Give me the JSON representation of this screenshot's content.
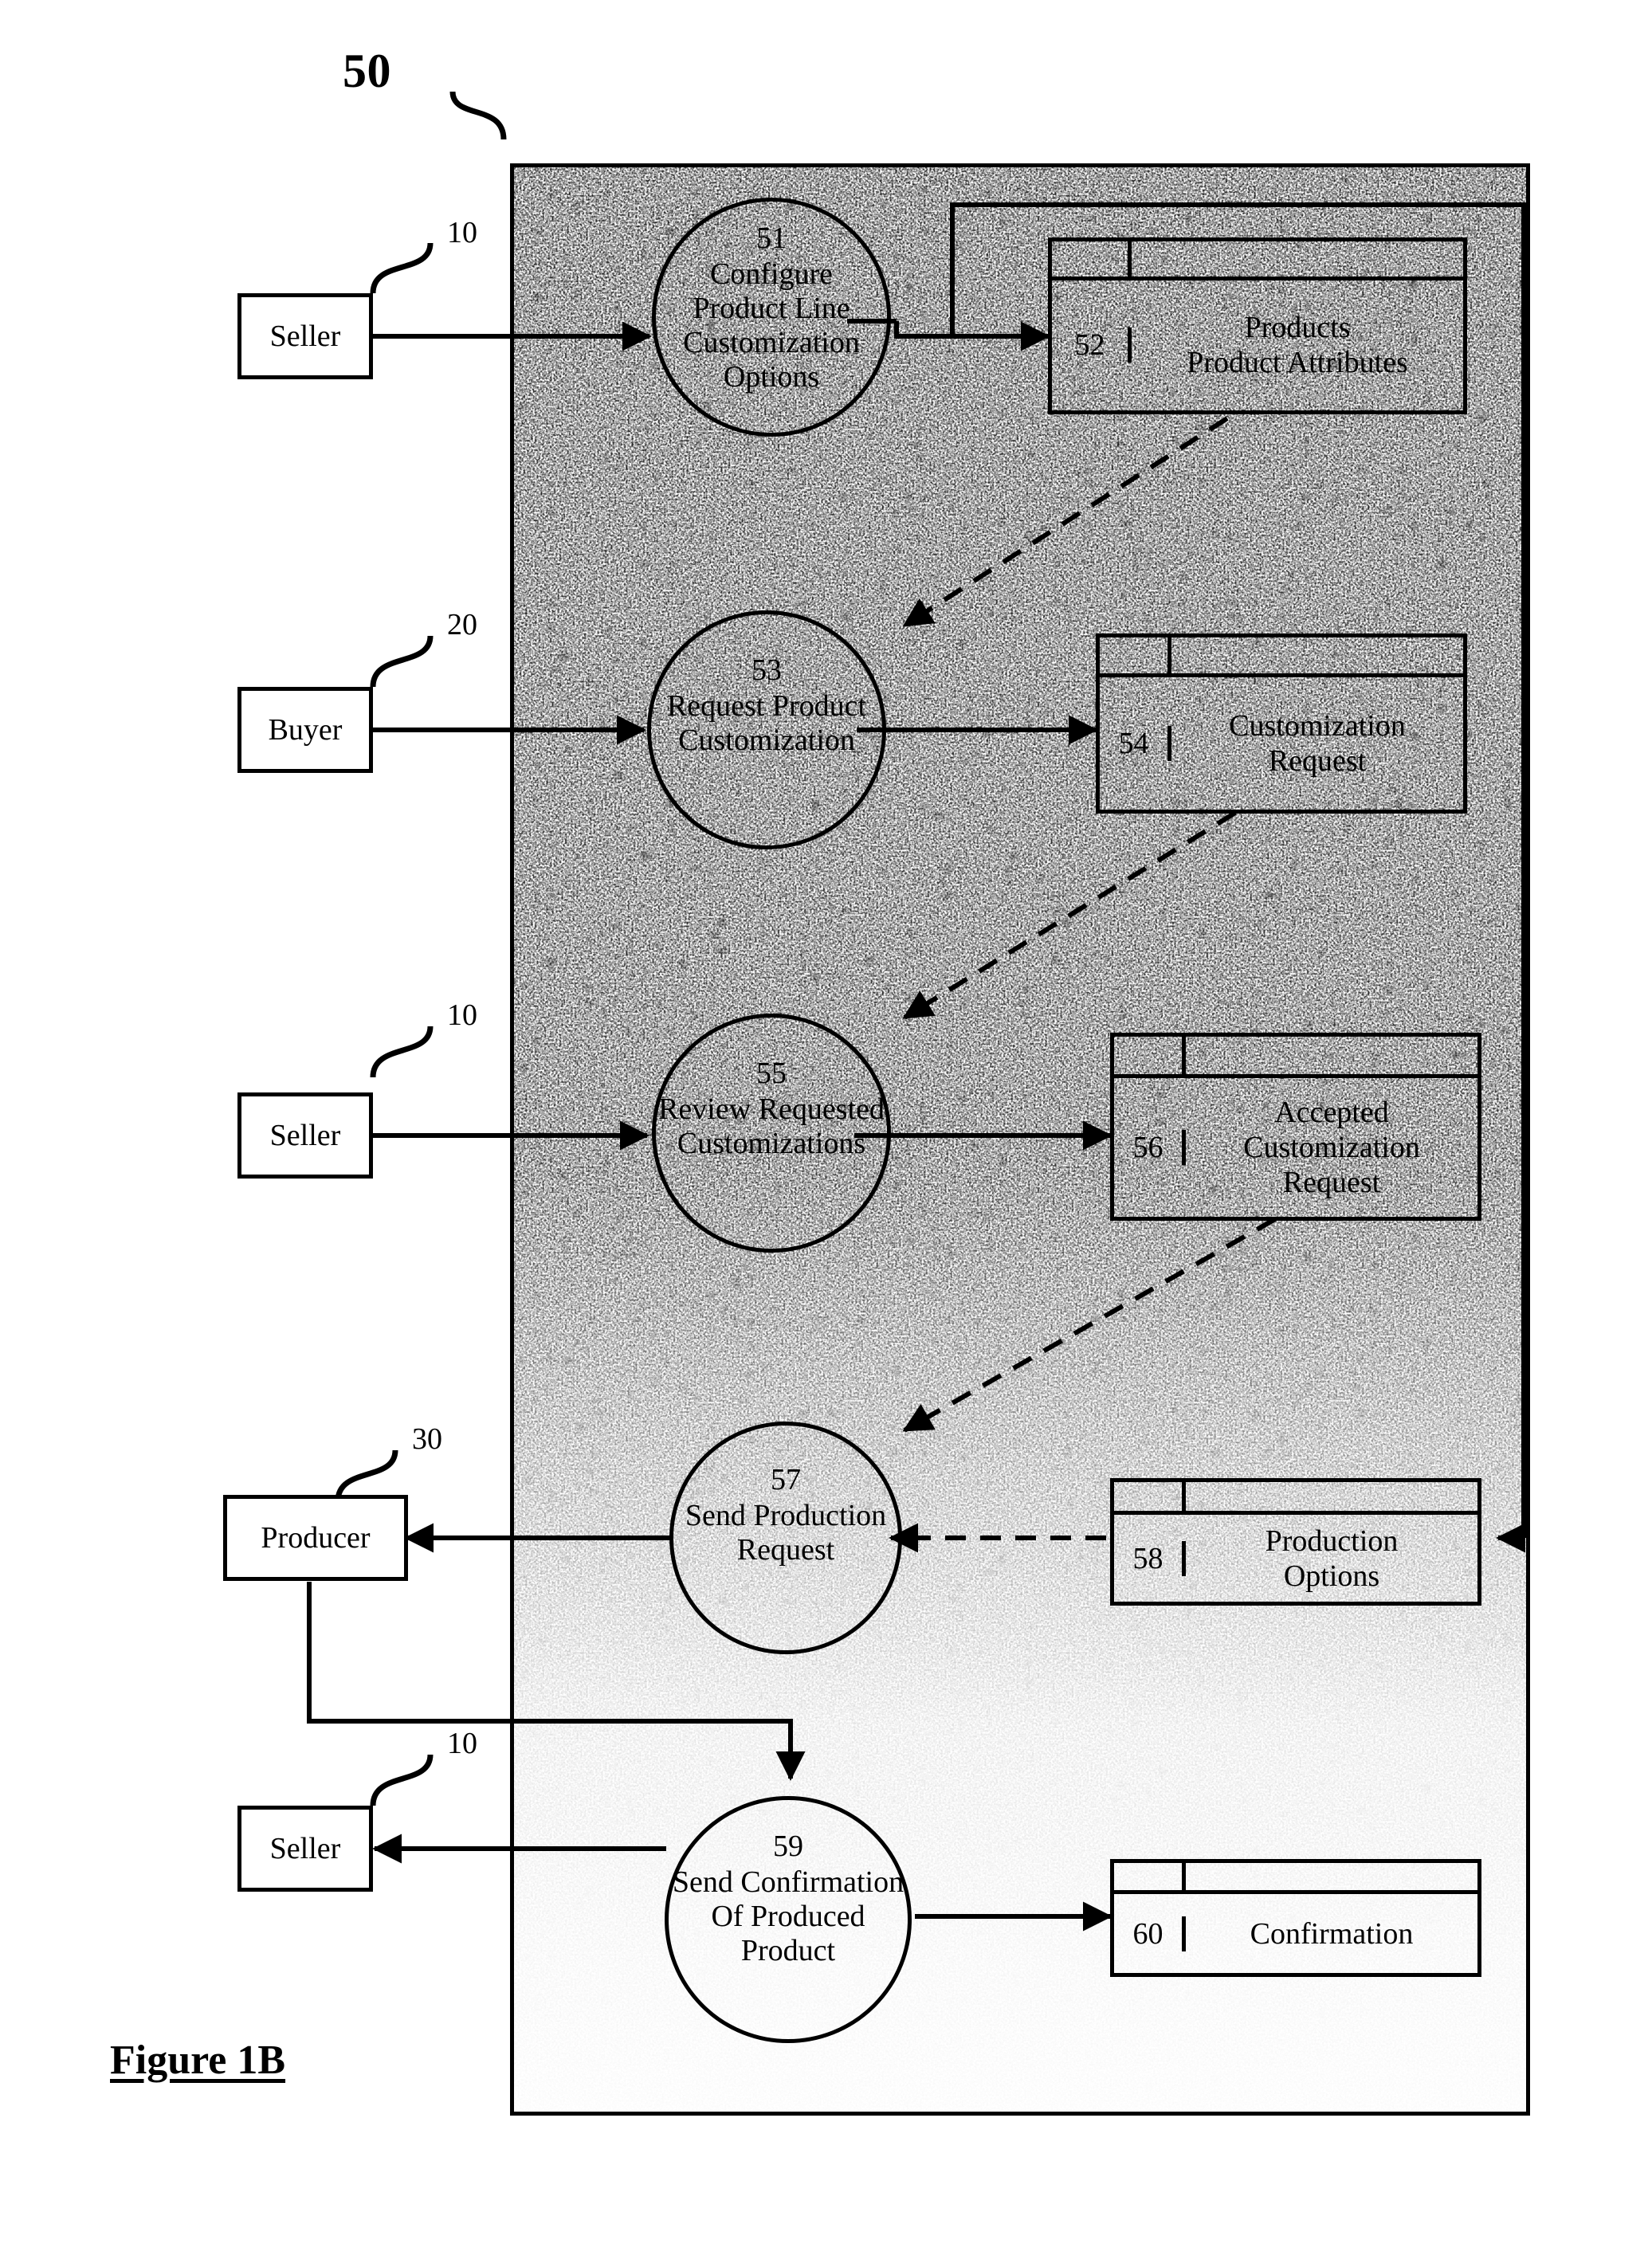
{
  "figure": {
    "caption": "Figure 1B",
    "system_ref": "50"
  },
  "entities": [
    {
      "name": "seller-1",
      "label": "Seller",
      "ref": "10"
    },
    {
      "name": "buyer",
      "label": "Buyer",
      "ref": "20"
    },
    {
      "name": "seller-2",
      "label": "Seller",
      "ref": "10"
    },
    {
      "name": "producer",
      "label": "Producer",
      "ref": "30"
    },
    {
      "name": "seller-3",
      "label": "Seller",
      "ref": "10"
    }
  ],
  "processes": [
    {
      "id": "51",
      "lines": [
        "Configure",
        "Product Line",
        "Customization",
        "Options"
      ]
    },
    {
      "id": "53",
      "lines": [
        "Request Product",
        "Customization"
      ]
    },
    {
      "id": "55",
      "lines": [
        "Review Requested",
        "Customizations"
      ]
    },
    {
      "id": "57",
      "lines": [
        "Send Production",
        "Request"
      ]
    },
    {
      "id": "59",
      "lines": [
        "Send Confirmation",
        "Of Produced",
        "Product"
      ]
    }
  ],
  "data_stores": [
    {
      "id": "52",
      "lines": [
        "Products",
        "Product Attributes"
      ]
    },
    {
      "id": "54",
      "lines": [
        "Customization",
        "Request"
      ]
    },
    {
      "id": "56",
      "lines": [
        "Accepted",
        "Customization",
        "Request"
      ]
    },
    {
      "id": "58",
      "lines": [
        "Production",
        "Options"
      ]
    },
    {
      "id": "60",
      "lines": [
        "Confirmation"
      ]
    }
  ],
  "colors": {
    "ink": "#000000",
    "paper": "#ffffff"
  }
}
